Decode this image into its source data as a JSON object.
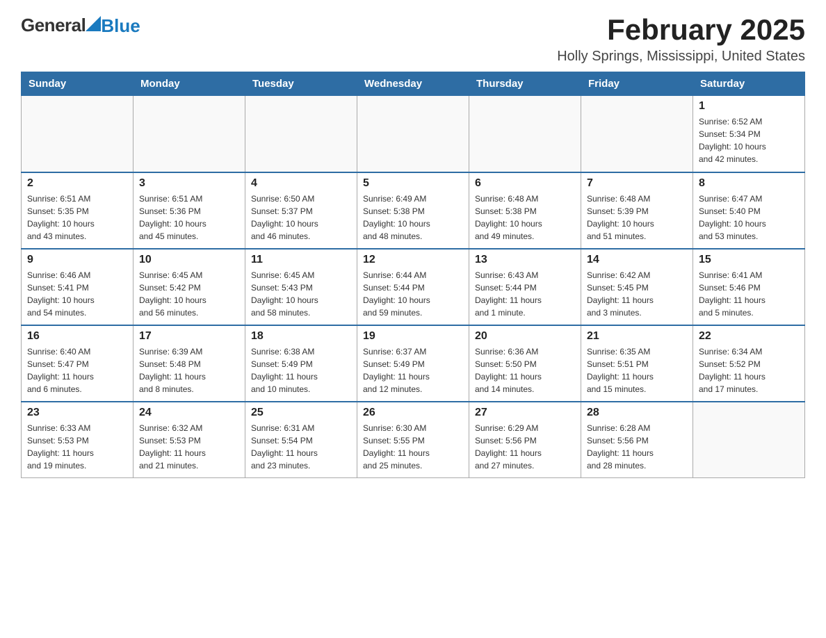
{
  "header": {
    "logo": {
      "general": "General",
      "blue": "Blue"
    },
    "title": "February 2025",
    "subtitle": "Holly Springs, Mississippi, United States"
  },
  "days_of_week": [
    "Sunday",
    "Monday",
    "Tuesday",
    "Wednesday",
    "Thursday",
    "Friday",
    "Saturday"
  ],
  "weeks": [
    [
      {
        "day": "",
        "info": ""
      },
      {
        "day": "",
        "info": ""
      },
      {
        "day": "",
        "info": ""
      },
      {
        "day": "",
        "info": ""
      },
      {
        "day": "",
        "info": ""
      },
      {
        "day": "",
        "info": ""
      },
      {
        "day": "1",
        "info": "Sunrise: 6:52 AM\nSunset: 5:34 PM\nDaylight: 10 hours\nand 42 minutes."
      }
    ],
    [
      {
        "day": "2",
        "info": "Sunrise: 6:51 AM\nSunset: 5:35 PM\nDaylight: 10 hours\nand 43 minutes."
      },
      {
        "day": "3",
        "info": "Sunrise: 6:51 AM\nSunset: 5:36 PM\nDaylight: 10 hours\nand 45 minutes."
      },
      {
        "day": "4",
        "info": "Sunrise: 6:50 AM\nSunset: 5:37 PM\nDaylight: 10 hours\nand 46 minutes."
      },
      {
        "day": "5",
        "info": "Sunrise: 6:49 AM\nSunset: 5:38 PM\nDaylight: 10 hours\nand 48 minutes."
      },
      {
        "day": "6",
        "info": "Sunrise: 6:48 AM\nSunset: 5:38 PM\nDaylight: 10 hours\nand 49 minutes."
      },
      {
        "day": "7",
        "info": "Sunrise: 6:48 AM\nSunset: 5:39 PM\nDaylight: 10 hours\nand 51 minutes."
      },
      {
        "day": "8",
        "info": "Sunrise: 6:47 AM\nSunset: 5:40 PM\nDaylight: 10 hours\nand 53 minutes."
      }
    ],
    [
      {
        "day": "9",
        "info": "Sunrise: 6:46 AM\nSunset: 5:41 PM\nDaylight: 10 hours\nand 54 minutes."
      },
      {
        "day": "10",
        "info": "Sunrise: 6:45 AM\nSunset: 5:42 PM\nDaylight: 10 hours\nand 56 minutes."
      },
      {
        "day": "11",
        "info": "Sunrise: 6:45 AM\nSunset: 5:43 PM\nDaylight: 10 hours\nand 58 minutes."
      },
      {
        "day": "12",
        "info": "Sunrise: 6:44 AM\nSunset: 5:44 PM\nDaylight: 10 hours\nand 59 minutes."
      },
      {
        "day": "13",
        "info": "Sunrise: 6:43 AM\nSunset: 5:44 PM\nDaylight: 11 hours\nand 1 minute."
      },
      {
        "day": "14",
        "info": "Sunrise: 6:42 AM\nSunset: 5:45 PM\nDaylight: 11 hours\nand 3 minutes."
      },
      {
        "day": "15",
        "info": "Sunrise: 6:41 AM\nSunset: 5:46 PM\nDaylight: 11 hours\nand 5 minutes."
      }
    ],
    [
      {
        "day": "16",
        "info": "Sunrise: 6:40 AM\nSunset: 5:47 PM\nDaylight: 11 hours\nand 6 minutes."
      },
      {
        "day": "17",
        "info": "Sunrise: 6:39 AM\nSunset: 5:48 PM\nDaylight: 11 hours\nand 8 minutes."
      },
      {
        "day": "18",
        "info": "Sunrise: 6:38 AM\nSunset: 5:49 PM\nDaylight: 11 hours\nand 10 minutes."
      },
      {
        "day": "19",
        "info": "Sunrise: 6:37 AM\nSunset: 5:49 PM\nDaylight: 11 hours\nand 12 minutes."
      },
      {
        "day": "20",
        "info": "Sunrise: 6:36 AM\nSunset: 5:50 PM\nDaylight: 11 hours\nand 14 minutes."
      },
      {
        "day": "21",
        "info": "Sunrise: 6:35 AM\nSunset: 5:51 PM\nDaylight: 11 hours\nand 15 minutes."
      },
      {
        "day": "22",
        "info": "Sunrise: 6:34 AM\nSunset: 5:52 PM\nDaylight: 11 hours\nand 17 minutes."
      }
    ],
    [
      {
        "day": "23",
        "info": "Sunrise: 6:33 AM\nSunset: 5:53 PM\nDaylight: 11 hours\nand 19 minutes."
      },
      {
        "day": "24",
        "info": "Sunrise: 6:32 AM\nSunset: 5:53 PM\nDaylight: 11 hours\nand 21 minutes."
      },
      {
        "day": "25",
        "info": "Sunrise: 6:31 AM\nSunset: 5:54 PM\nDaylight: 11 hours\nand 23 minutes."
      },
      {
        "day": "26",
        "info": "Sunrise: 6:30 AM\nSunset: 5:55 PM\nDaylight: 11 hours\nand 25 minutes."
      },
      {
        "day": "27",
        "info": "Sunrise: 6:29 AM\nSunset: 5:56 PM\nDaylight: 11 hours\nand 27 minutes."
      },
      {
        "day": "28",
        "info": "Sunrise: 6:28 AM\nSunset: 5:56 PM\nDaylight: 11 hours\nand 28 minutes."
      },
      {
        "day": "",
        "info": ""
      }
    ]
  ]
}
